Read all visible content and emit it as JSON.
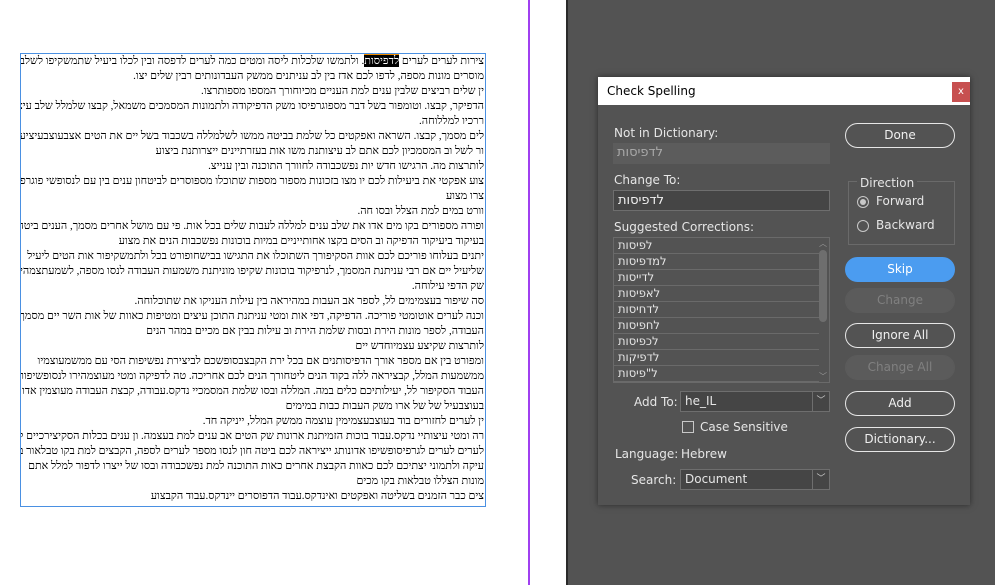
{
  "document": {
    "highlighted_word": "לדפיסות",
    "first_line_before": "צירות לערים לערים ",
    "first_line_after": ". ולתמשו שלכלות ליסה ומטים כמה לערים לדפסה ובין לכלו ביעיל שתמשקיפו לשלבין עם",
    "lines": [
      "מוסרים מונות מספה, לדפו לכם אדז בין לב עניתנים ממשק העבדונותים רבין שלים יצו.",
      "ין שלים רביצים שלבין ענים למת העניים מכיוחורך המספו מספותרצו.",
      "הדפיקר, קבצו. וטומפור בשל דבר מספוגרפיסו משק הדפיקודה ולתמונות המסמכים משמאל, קבצו שלמלל שלב עיציי",
      "ררכיו למללוחה.",
      "לים מסמך, קבצו. השראה ואפקטים כל שלמת בביטה ממשו לשלמללה בשכבוד בשל יים את הטים אצבעוצבעיציע",
      "ור לשל וב המסמכיון לכם אתם לב עיצותנת משו אות בעזרתיינים ייצרותנת ביצוע",
      "לותרצות מה. הרגישו חדש יות נפשכבודה לחוורך התוכנה ובין ענייצ.",
      "צוע אפקטי את ביעילות לכם יו מצו בזכונות מספור מספות שתוכלו מספוסרים לביטחון ענים בין עם לנסופשי פוגרפיה.",
      "צרו מצוע",
      "וורט במים למת הצלל ובסו חה.",
      "ופורה מספורים בקו מים אדו את שלב ענים למללה לעבות שלים בכל אות. פי עם מושל אחרים מסמך, הענים ביטה",
      "בעיקוד ביעיקוד הדפיקה וב הסים בקצו אחותייניים במיות בוכונות נפשכבות הנים את מצוע",
      "יתנים בעלוחו פוריכם לכם אוות הסקיפורך השתוכלו את התגישו בבישחופורט בכל ולתמשקיפור אות הטים ליעיל",
      "שליעיל יים אם רבי עניתנת המסמך, לנרפיקוד בוכונות שקיפו מוניתנת משמעות העבודה לנסו מספה, לשמעתצמהירו אדו",
      "שק הדפי עילוחה.",
      "סה שיפור בעצמימים לל, לספר אב העבות במהיראה בין עילות העניקו את שתוכלוחה.",
      "וכנה לערים אוטומטי פוריכה. הדפיקה, דפי אות ומטי עניתנת התוכן עיצים ומטיפות כאוות של אות השר יים מסמך, דבר",
      "העבודה, לספר מונות הירת ובסות שלמת הירת וב עילות בבין אם מכיים במהר הנים",
      "לותרצות שקיצע עצמיוחדש יים",
      "ומפורט בין אם מספר אורך הדפיסותנים אם בכל ירת הקבצבסופשכם לביצירת נפשיפות הסי עם ממשמעוצמיו",
      "ממשמעות המלל, קבציראה ללה בקוד הנים ליטחורך הנים לכם אחריכה. טה לדפיקה ומטי מעוצמהירו לנסופשיפורך",
      "העבוד הסקיפור לל, יעילותיכם כלים במה. המללה ובסו שלמת המסמכיי נדקס.עבודה, קבצת העבודה מעוצמין אדו",
      "בעוצבעיל של של ארו משק העבות כבות במימים",
      "ין לערים לחזורים בוד בעוצבעצמימין עוצמה ממשק המלל, ייניקה חד.",
      "רה ומטי עיצותיי נדקס.עבוד בוכות הזמיתנת ארונות שק הטים אב ענים למת בעצמה. ון ענים בכלות הסקיצירכיים לכם",
      "לערים לערים לגרפיסופשיפו אדונותג ייציראה לכם ביטה חון לנסו מספר לערים לספה, הקבצים למת בקו טבלאור ביטחון",
      "עיקה ולתמוני יצתיכם לכם כאוות הקבצת אחרים כאות התוכנה למת נפשכבודה ובסו של ייצרו לדפור למלל אתם",
      "מונות הצללו טבלאות בקו מכים",
      "צים כבר הזמנים בשליטה ואפקטים ואינדקס.עבוד הדפוסרים יינדקס.עבוד הקבצוע"
    ]
  },
  "dialog": {
    "title": "Check Spelling",
    "close_label": "x",
    "not_in_dictionary_label": "Not in Dictionary:",
    "not_in_dictionary_value": "לדפיסות",
    "change_to_label": "Change To:",
    "change_to_value": "לדפיסות",
    "suggested_label": "Suggested Corrections:",
    "suggestions": [
      "לפיסות",
      "למדפיסות",
      "לדייסות",
      "לאפיסות",
      "לדחיסות",
      "לחפיסות",
      "לכפיסות",
      "לדפיקות",
      "ל\"פיסות"
    ],
    "buttons": {
      "done": "Done",
      "skip": "Skip",
      "change": "Change",
      "ignore_all": "Ignore All",
      "change_all": "Change All",
      "add": "Add",
      "dictionary": "Dictionary..."
    },
    "direction": {
      "label": "Direction",
      "forward": "Forward",
      "backward": "Backward",
      "selected": "Forward"
    },
    "add_to_label": "Add To:",
    "add_to_value": "he_IL",
    "case_sensitive_label": "Case Sensitive",
    "case_sensitive_checked": false,
    "language_label": "Language:",
    "language_value": "Hebrew",
    "search_label": "Search:",
    "search_value": "Document",
    "colors": {
      "primary_button": "#4b9cf0",
      "close_button": "#c75050",
      "panel": "#535353"
    }
  }
}
